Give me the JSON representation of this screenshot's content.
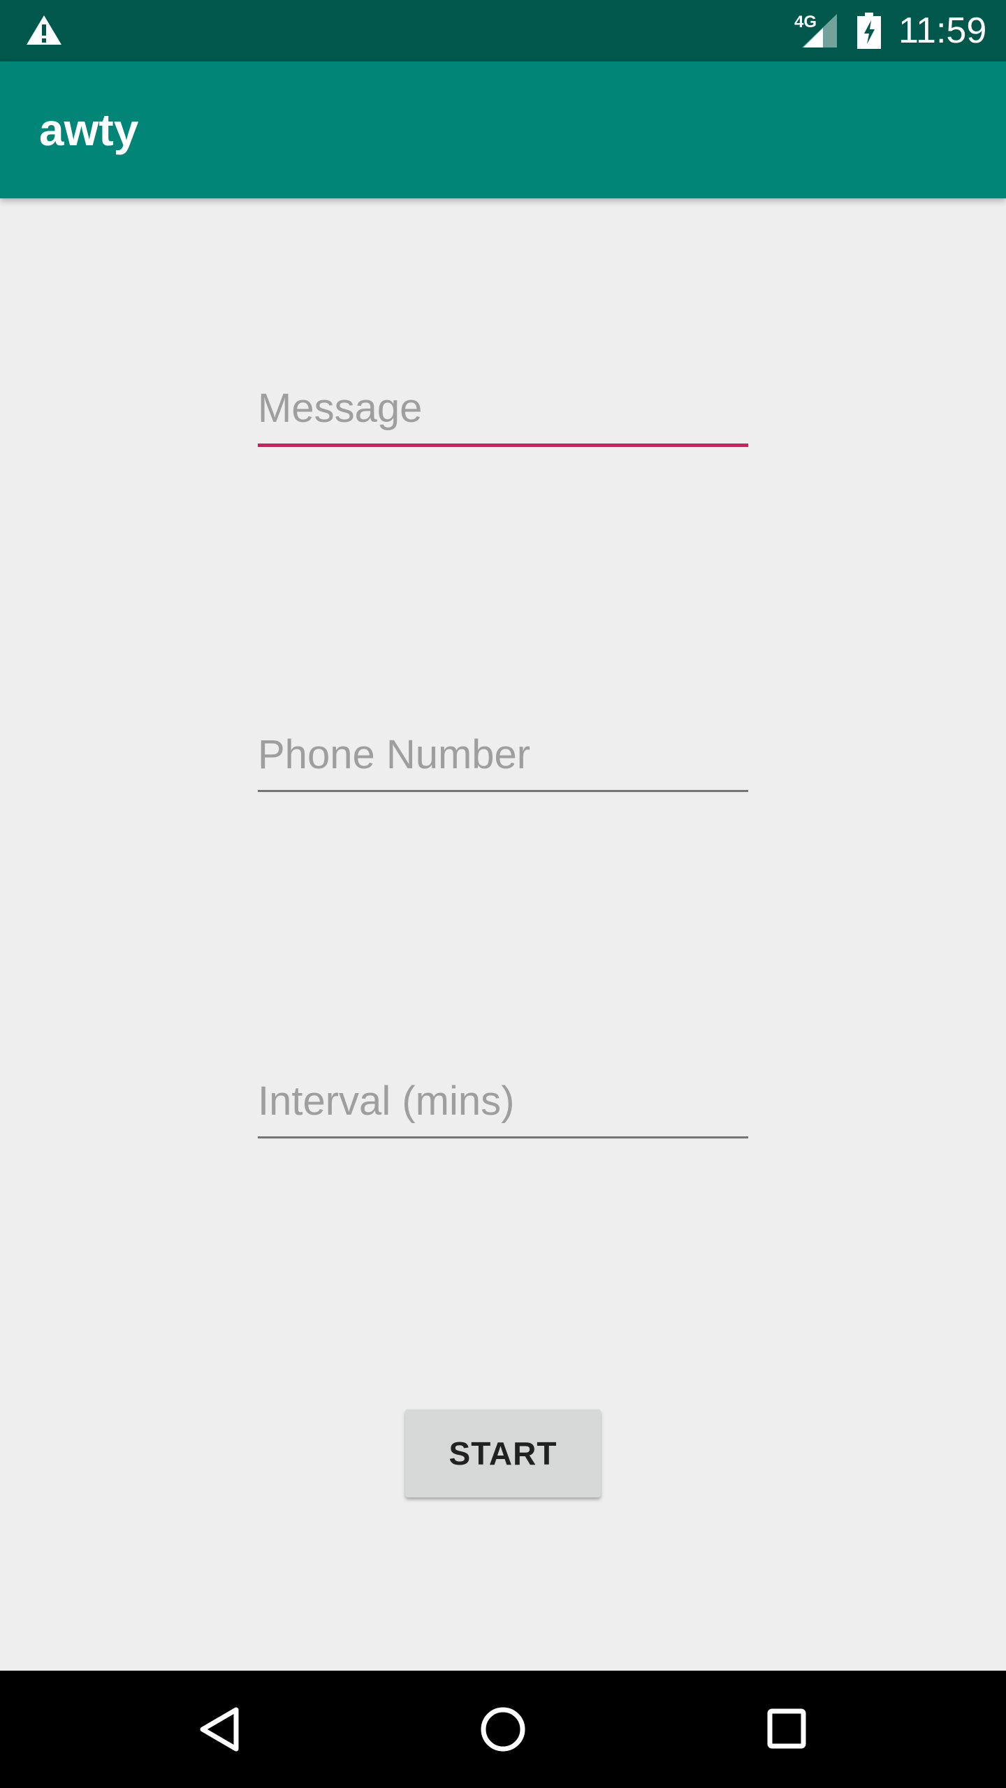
{
  "status_bar": {
    "time": "11:59",
    "network_type": "4G",
    "icons": {
      "alert": "warning-icon",
      "signal": "signal-icon",
      "battery": "battery-charging-icon"
    }
  },
  "app_bar": {
    "title": "awty",
    "color": "#008577"
  },
  "form": {
    "message": {
      "placeholder": "Message",
      "value": "",
      "focused": true
    },
    "phone": {
      "placeholder": "Phone Number",
      "value": ""
    },
    "interval": {
      "placeholder": "Interval (mins)",
      "value": ""
    },
    "start_label": "START"
  },
  "nav_bar": {
    "icons": [
      "back-icon",
      "home-icon",
      "recents-icon"
    ]
  },
  "colors": {
    "status_bar": "#00574b",
    "primary": "#008577",
    "accent": "#d81b60",
    "background": "#eeeeee"
  }
}
